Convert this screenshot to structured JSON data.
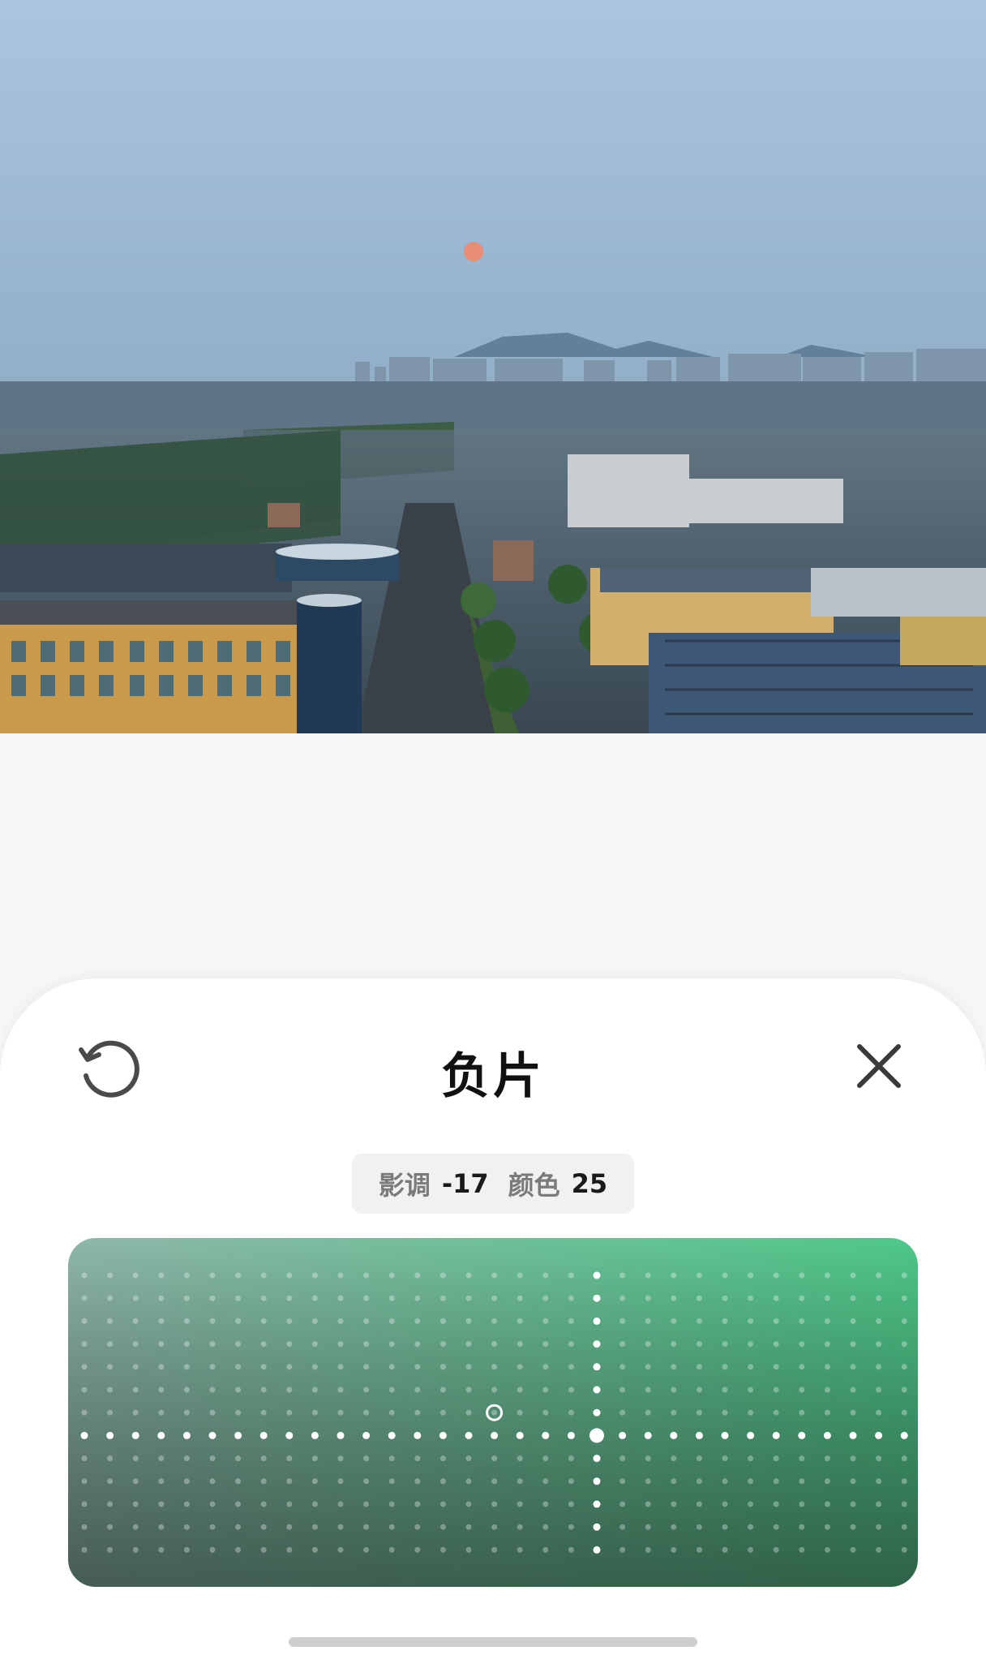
{
  "photo": {
    "description_icon": "photo-preview",
    "sky_top": "#a9c4dc",
    "sky_bottom": "#6f93ad",
    "sun_color": "#f08a6a"
  },
  "editor": {
    "title": "负片",
    "reset_icon": "rotate-ccw-icon",
    "close_icon": "close-icon"
  },
  "readout": {
    "tone_label": "影调",
    "tone_value": "-17",
    "color_label": "颜色",
    "color_value": "25"
  },
  "pad": {
    "tone": -17,
    "color": 25,
    "gradient_top_left": "#8fb8aa",
    "gradient_top_right": "#4fc98a",
    "gradient_bottom_left": "#4d5752",
    "gradient_bottom_right": "#3f7a58",
    "dot_color": "#ffffff"
  }
}
